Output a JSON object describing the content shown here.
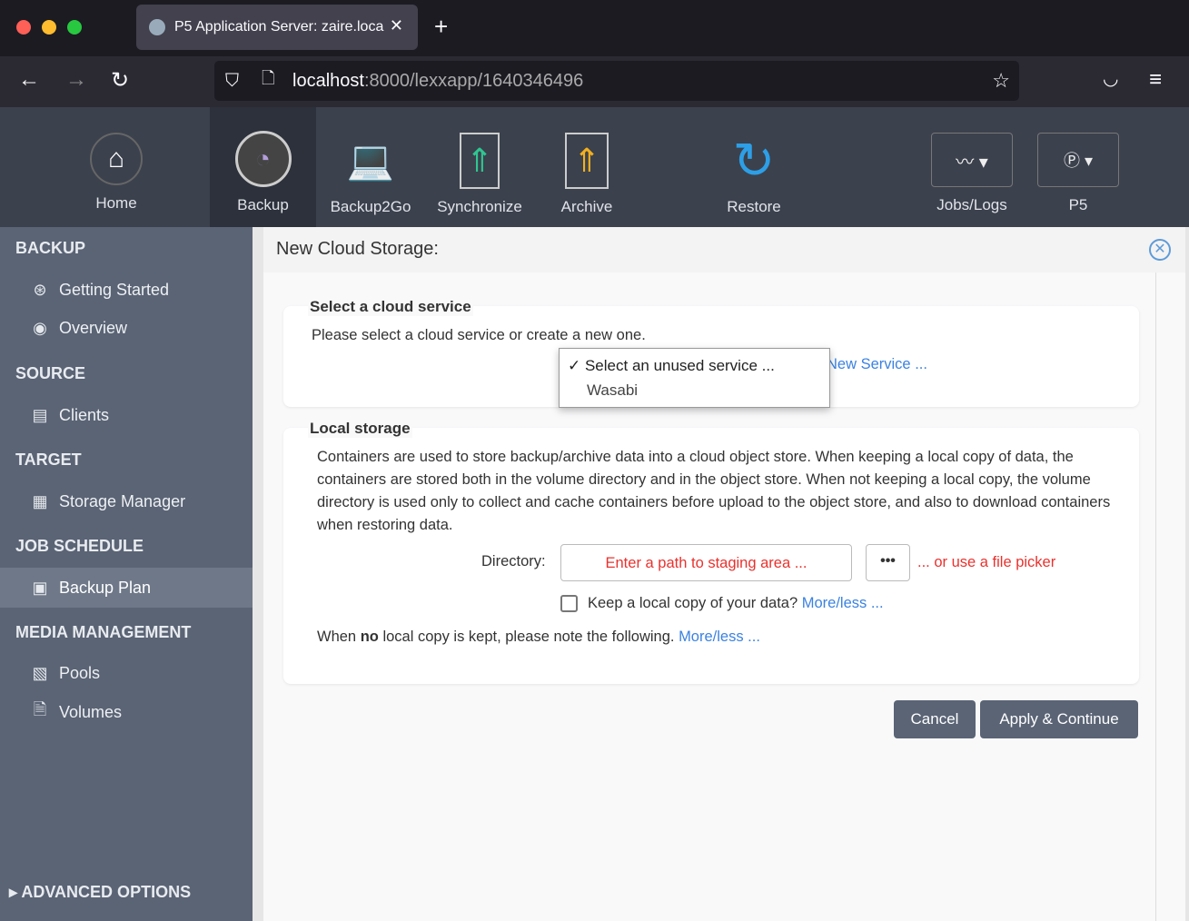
{
  "browser": {
    "tab_title": "P5 Application Server: zaire.loca",
    "new_tab": "+",
    "url_host": "localhost",
    "url_rest": ":8000/lexxapp/1640346496"
  },
  "toolbar": [
    {
      "label": "Home",
      "icon": "home-icon"
    },
    {
      "label": "Backup",
      "icon": "backup-clock-icon",
      "active": true
    },
    {
      "label": "Backup2Go",
      "icon": "laptop-icon"
    },
    {
      "label": "Synchronize",
      "icon": "sync-icon"
    },
    {
      "label": "Archive",
      "icon": "archive-icon"
    },
    {
      "label": "Restore",
      "icon": "restore-icon"
    },
    {
      "label": "Jobs/Logs",
      "icon": "jobs-icon"
    },
    {
      "label": "P5",
      "icon": "p5-icon"
    }
  ],
  "sidebar": {
    "sections": [
      {
        "title": "BACKUP",
        "items": [
          "Getting Started",
          "Overview"
        ]
      },
      {
        "title": "SOURCE",
        "items": [
          "Clients"
        ]
      },
      {
        "title": "TARGET",
        "items": [
          "Storage Manager"
        ]
      },
      {
        "title": "JOB SCHEDULE",
        "items": [
          "Backup Plan"
        ]
      },
      {
        "title": "MEDIA MANAGEMENT",
        "items": [
          "Pools",
          "Volumes"
        ]
      }
    ],
    "active": "Backup Plan",
    "advanced": "ADVANCED OPTIONS"
  },
  "dialog": {
    "title": "New Cloud Storage:",
    "cloud": {
      "legend": "Select a cloud service",
      "text": "Please select a cloud service or create a new one.",
      "new_service": "New Service ...",
      "options": [
        "Select an unused service ...",
        "Wasabi"
      ],
      "selected": "Select an unused service ..."
    },
    "local": {
      "legend": "Local storage",
      "text": "Containers are used to store backup/archive data into a cloud object store. When keeping a local copy of data, the containers are stored both in the volume directory and in the object store. When not keeping a local copy, the volume directory is used only to collect and cache containers before upload to the object store, and also to download containers when restoring data.",
      "dir_label": "Directory:",
      "dir_placeholder": "Enter a path to staging area ...",
      "picker_btn": "•••",
      "picker_text": "... or use a file picker",
      "keep_label": "Keep a local copy of your data?",
      "more1": "More/less ...",
      "note_pre": "When ",
      "note_bold": "no",
      "note_post": " local copy is kept, please note the following.",
      "more2": "More/less ..."
    },
    "cancel": "Cancel",
    "apply": "Apply & Continue"
  }
}
